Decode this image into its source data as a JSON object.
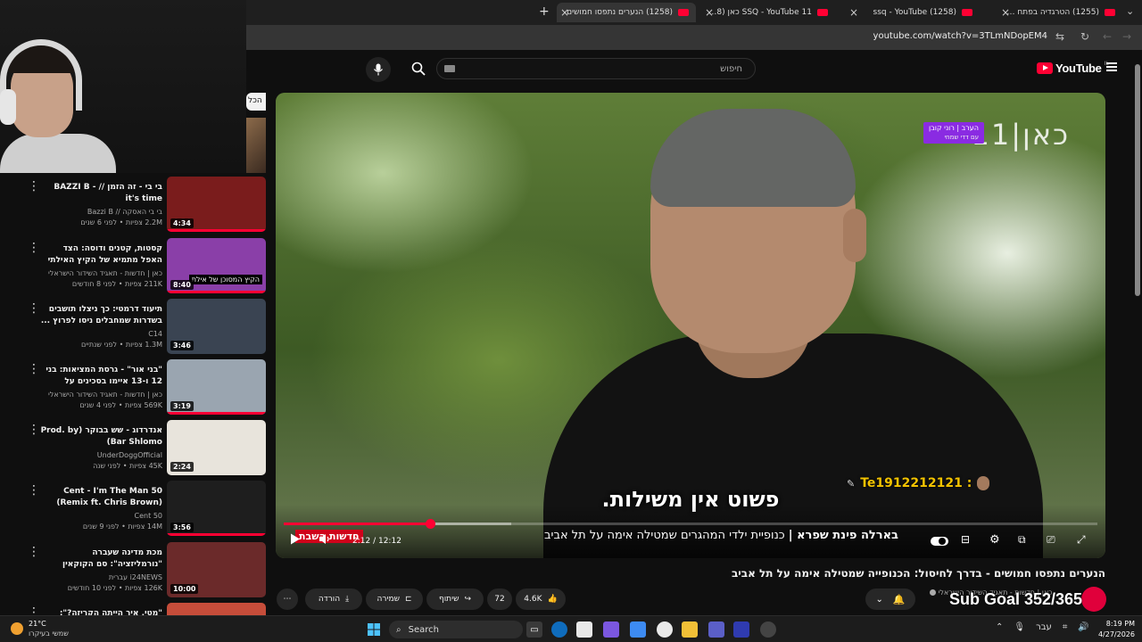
{
  "browser": {
    "tabs": [
      {
        "title": "(1255) הטרגדיה בפתח תקווה: ..."
      },
      {
        "title": "(1258) ssq - YouTube"
      },
      {
        "title": "SSQ - YouTube 11 כאן (1258)"
      },
      {
        "title": "(1258) הנערים נתפסו חמושים",
        "active": true
      }
    ],
    "new_tab": "+",
    "url": "youtube.com/watch?v=3TLmNDopEM4"
  },
  "header": {
    "search_placeholder": "חיפוש",
    "logo_text": "YouTube",
    "logo_country": "IL"
  },
  "sidebar": {
    "chip_label": "הכל",
    "items": [
      {
        "title": "בי בי - זה הזמן // BAZZI B - it's time",
        "channel": "בי בי האסקה // Bazzi B",
        "meta": "2.2M צפיות • לפני 6 שנים",
        "duration": "4:34",
        "progress": 1.0,
        "thumb_color": "#7a1c1c"
      },
      {
        "title": "קסטות, קטנים ודוסה: הצד האפל מתמיא של הקיץ האילתי",
        "channel": "כאן | חדשות - תאגיד השידור הישראלי",
        "meta": "211K צפיות • לפני 8 חודשים",
        "duration": "8:40",
        "progress": 1.0,
        "caption": "הקיץ המסוכן של אילת",
        "thumb_color": "#8a3fa8"
      },
      {
        "title": "תיעוד דרמטי: כך ניצלו תושבים בשדרות שמחבלים ניסו לפרוץ ...",
        "channel": "C14",
        "meta": "1.3M צפיות • לפני שנתיים",
        "duration": "3:46",
        "progress": 0,
        "thumb_color": "#3a4452"
      },
      {
        "title": "\"בני אור\" - גרסת המציאות: בני 12 ו-13 איימו בסכינים על סטודנטים ...",
        "channel": "כאן | חדשות - תאגיד השידור הישראלי",
        "meta": "569K צפיות • לפני 4 שנים",
        "duration": "3:19",
        "progress": 1.0,
        "thumb_color": "#9aa5b0"
      },
      {
        "title": "אנדרדוג - שש בבוקר (Prod. by Bar Shlomo)",
        "channel": "UnderDoggOfficial",
        "meta": "45K צפיות • לפני שנה",
        "duration": "2:24",
        "progress": 0,
        "thumb_color": "#e8e4dc"
      },
      {
        "title": "50 Cent - I'm The Man (Remix ft. Chris Brown) [CDQ / Dirty]",
        "channel": "50 Cent",
        "meta": "14M צפיות • לפני 9 שנים",
        "duration": "3:56",
        "progress": 1.0,
        "thumb_color": "#1e1e1e"
      },
      {
        "title": "מכת מדינה שעברה \"נורמליזציה\": סם הקוקאין נמצא בכל מקום - האם הנ...",
        "channel": "i24NEWS עברית",
        "meta": "126K צפיות • לפני 10 חודשים",
        "duration": "10:00",
        "progress": 0,
        "thumb_color": "#6b2a2a"
      },
      {
        "title": "\"מטי, איך הייתה הקריזה?\": משפחות ...",
        "channel": "",
        "meta": "",
        "duration": "",
        "progress": 1.0,
        "thumb_color": "#c64d3a"
      }
    ]
  },
  "player": {
    "channel_logo": "כאן|11",
    "channel_tag_line1": "הערב | רוני קובן",
    "channel_tag_line2": "עם דדי שמחי",
    "subtitle": "פשוט אין משילות.",
    "chat_overlay": "Te1912212121 :",
    "ticker_label": "חדשות השבת",
    "ticker_name": "בארלה פינת שפרא |",
    "ticker_text": "כנופיית ילדי המהגרים שמטילה אימה על תל אביב",
    "time_current": "2:12",
    "time_total": "12:12",
    "played_fraction": 0.18,
    "buffered_fraction": 0.28
  },
  "video": {
    "title": "הנערים נתפסו חמושים - בדרך לחיסול: הכנופייה שמטילה אימה על תל אביב",
    "channel": "כאן | חדשות - תאגיד השידור הישראלי",
    "subs": "768K מנויים",
    "likes": "4.6K",
    "comments": "72",
    "share_label": "שיתוף",
    "save_label": "שמירה",
    "download_label": "הורדה"
  },
  "overlay": {
    "subgoal": "Sub Goal 352/365"
  },
  "taskbar": {
    "temperature": "21°C",
    "weather_desc": "שמשי בעיקרו",
    "search_label": "Search",
    "language": "עבר",
    "time": "8:19 PM",
    "date": "4/27/2026"
  },
  "colors": {
    "yt_red": "#ff0033",
    "background": "#0f0f0f",
    "pill": "#272727",
    "overlay_yellow": "#f2c200"
  }
}
